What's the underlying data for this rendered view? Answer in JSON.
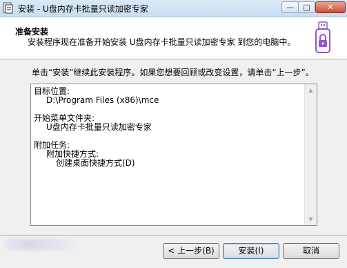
{
  "window": {
    "title": "安装 - U盘内存卡批量只读加密专家",
    "minimize_glyph": "—",
    "maximize_glyph": "□",
    "close_glyph": "✕"
  },
  "header": {
    "title": "准备安装",
    "subtitle": "安装程序现在准备开始安装 U盘内存卡批量只读加密专家 到您的电脑中。",
    "icon": "usb-lock-icon"
  },
  "intro": "单击“安装”继续此安装程序。如果您想要回顾或改变设置，请单击“上一步”。",
  "memo": {
    "dest_label": "目标位置:",
    "dest_value": "D:\\Program Files (x86)\\mce",
    "startmenu_label": "开始菜单文件夹:",
    "startmenu_value": "U盘内存卡批量只读加密专家",
    "tasks_label": "附加任务:",
    "tasks_group": "附加快捷方式:",
    "tasks_item": "创建桌面快捷方式(D)"
  },
  "buttons": {
    "back": "< 上一步(B)",
    "install": "安装(I)",
    "cancel": "取消"
  },
  "colors": {
    "titlebar": "#c9dcf1",
    "close": "#c8503a",
    "accent_border": "#3c7fb1",
    "background": "#f0f0f0"
  }
}
